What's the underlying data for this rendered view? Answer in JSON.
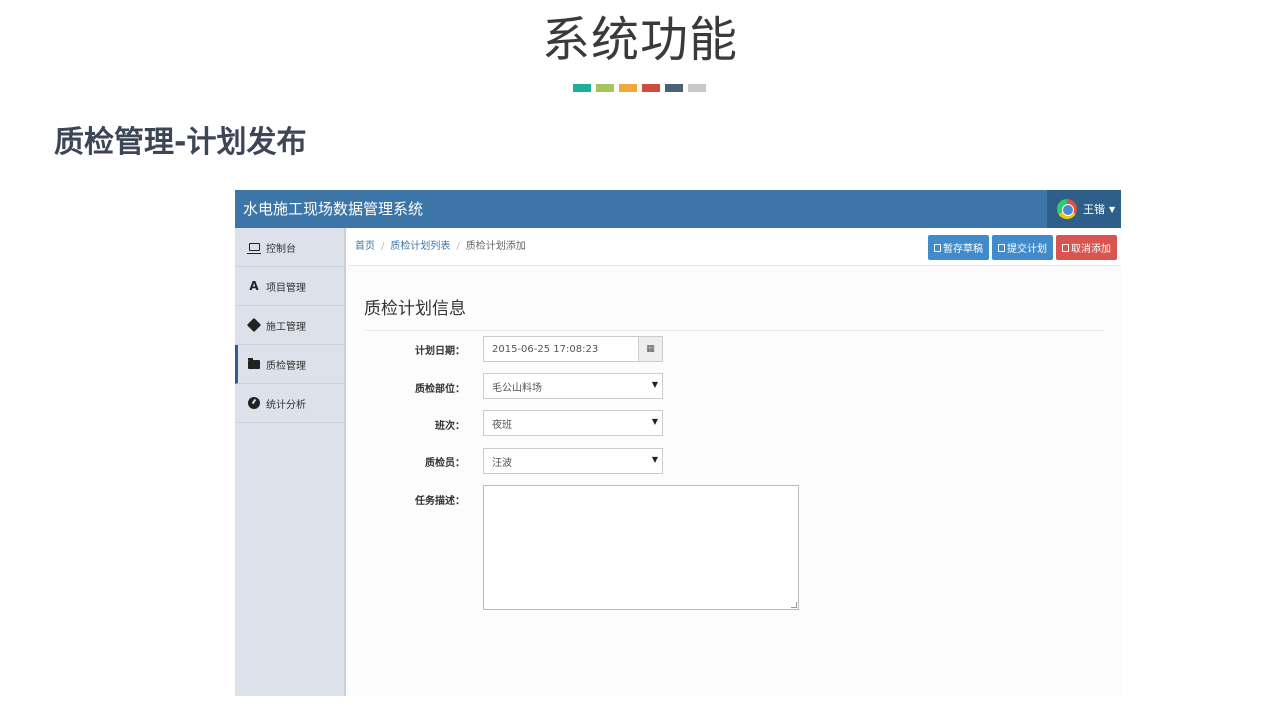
{
  "slide": {
    "title": "系统功能",
    "subtitle": "质检管理-计划发布",
    "bar_colors": [
      "#1fae9a",
      "#a5c45b",
      "#f0a838",
      "#cf4b3e",
      "#4a6276",
      "#c8c8c8"
    ]
  },
  "app": {
    "brand": "水电施工现场数据管理系统",
    "user": {
      "name": "王锴",
      "avatar_icon": "user-avatar-icon"
    },
    "sidebar": {
      "items": [
        {
          "label": "控制台",
          "icon": "laptop-icon"
        },
        {
          "label": "项目管理",
          "icon": "road-icon"
        },
        {
          "label": "施工管理",
          "icon": "tags-icon"
        },
        {
          "label": "质检管理",
          "icon": "folder-icon"
        },
        {
          "label": "统计分析",
          "icon": "dashboard-icon"
        }
      ],
      "active_index": 3
    },
    "breadcrumb": {
      "home": "首页",
      "list": "质检计划列表",
      "current": "质检计划添加",
      "separator": "/"
    },
    "buttons": {
      "save_draft": "暂存草稿",
      "submit": "提交计划",
      "cancel": "取消添加"
    },
    "form": {
      "title": "质检计划信息",
      "plan_date": {
        "label": "计划日期：",
        "value": "2015-06-25 17:08:23"
      },
      "location": {
        "label": "质检部位：",
        "value": "毛公山料场"
      },
      "shift": {
        "label": "班次：",
        "value": "夜班"
      },
      "inspector": {
        "label": "质检员：",
        "value": "汪波"
      },
      "description": {
        "label": "任务描述：",
        "value": ""
      }
    }
  }
}
